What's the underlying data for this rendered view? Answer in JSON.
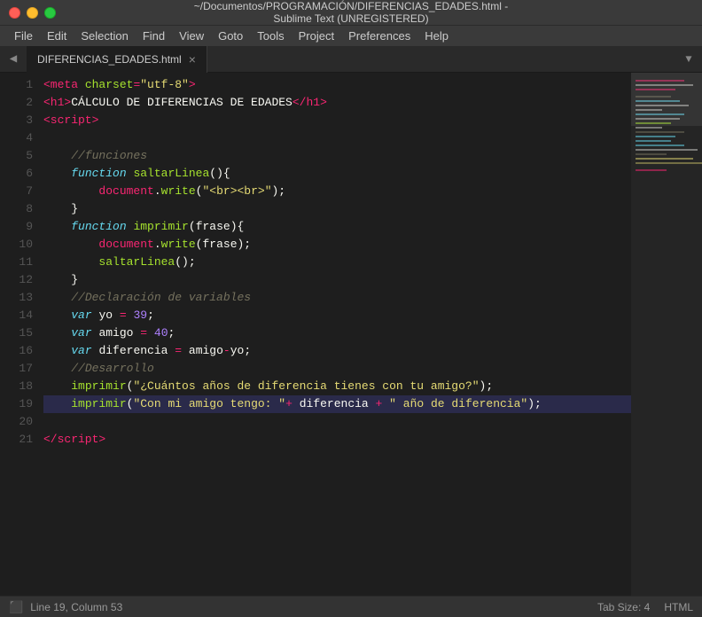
{
  "titlebar": {
    "title": "~/Documentos/PROGRAMACIÓN/DIFERENCIAS_EDADES.html - Sublime Text (UNREGISTERED)"
  },
  "menubar": {
    "items": [
      "File",
      "Edit",
      "Selection",
      "Find",
      "View",
      "Goto",
      "Tools",
      "Project",
      "Preferences",
      "Help"
    ]
  },
  "tab": {
    "filename": "DIFERENCIAS_EDADES.html",
    "close": "×"
  },
  "statusbar": {
    "position": "Line 19, Column 53",
    "tabsize": "Tab Size: 4",
    "syntax": "HTML"
  },
  "minimap": {
    "visible": true
  }
}
